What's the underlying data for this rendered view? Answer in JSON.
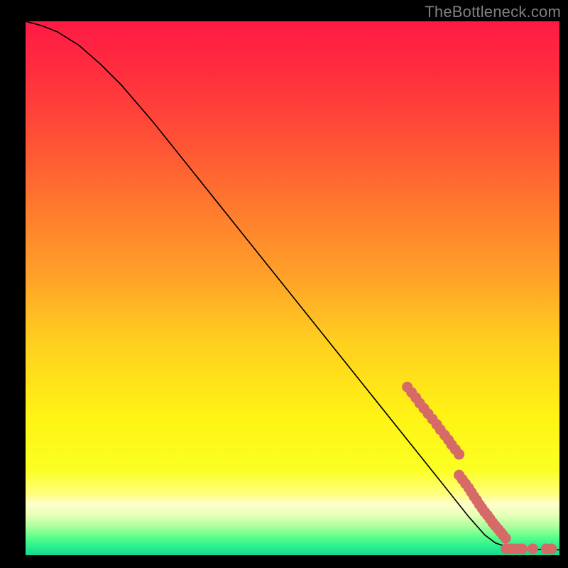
{
  "watermark": "TheBottleneck.com",
  "colors": {
    "background": "#000000",
    "watermark": "#808080",
    "curve": "#000000",
    "point": "#d66a66"
  },
  "gradient_stops": [
    {
      "offset": 0.0,
      "color": "#ff1a44"
    },
    {
      "offset": 0.1,
      "color": "#ff2f3e"
    },
    {
      "offset": 0.22,
      "color": "#ff5036"
    },
    {
      "offset": 0.35,
      "color": "#ff7a2e"
    },
    {
      "offset": 0.48,
      "color": "#ffa229"
    },
    {
      "offset": 0.6,
      "color": "#ffcf1f"
    },
    {
      "offset": 0.74,
      "color": "#fff314"
    },
    {
      "offset": 0.84,
      "color": "#fbff22"
    },
    {
      "offset": 0.885,
      "color": "#ffff80"
    },
    {
      "offset": 0.905,
      "color": "#ffffcc"
    },
    {
      "offset": 0.925,
      "color": "#e6ffb8"
    },
    {
      "offset": 0.945,
      "color": "#b0ff9e"
    },
    {
      "offset": 0.965,
      "color": "#5fff8b"
    },
    {
      "offset": 0.983,
      "color": "#2cf08f"
    },
    {
      "offset": 1.0,
      "color": "#17d892"
    }
  ],
  "chart_data": {
    "type": "line",
    "title": "",
    "xlabel": "",
    "ylabel": "",
    "xlim": [
      0,
      100
    ],
    "ylim": [
      0,
      100
    ],
    "grid": false,
    "legend": false,
    "curve": [
      {
        "x": 0,
        "y": 100
      },
      {
        "x": 3,
        "y": 99.2
      },
      {
        "x": 6,
        "y": 98.0
      },
      {
        "x": 10,
        "y": 95.5
      },
      {
        "x": 14,
        "y": 92.0
      },
      {
        "x": 18,
        "y": 88.0
      },
      {
        "x": 24,
        "y": 81.0
      },
      {
        "x": 30,
        "y": 73.5
      },
      {
        "x": 36,
        "y": 66.0
      },
      {
        "x": 42,
        "y": 58.5
      },
      {
        "x": 48,
        "y": 51.0
      },
      {
        "x": 54,
        "y": 43.5
      },
      {
        "x": 60,
        "y": 36.0
      },
      {
        "x": 66,
        "y": 28.5
      },
      {
        "x": 72,
        "y": 21.0
      },
      {
        "x": 78,
        "y": 13.5
      },
      {
        "x": 83,
        "y": 7.2
      },
      {
        "x": 86,
        "y": 3.8
      },
      {
        "x": 88,
        "y": 2.3
      },
      {
        "x": 90,
        "y": 1.6
      },
      {
        "x": 92,
        "y": 1.3
      },
      {
        "x": 94,
        "y": 1.15
      },
      {
        "x": 96,
        "y": 1.1
      },
      {
        "x": 98,
        "y": 1.05
      },
      {
        "x": 100,
        "y": 1.0
      }
    ],
    "scatter_points": [
      {
        "x": 71.5,
        "y": 31.5
      },
      {
        "x": 72.3,
        "y": 30.5
      },
      {
        "x": 73.1,
        "y": 29.5
      },
      {
        "x": 73.8,
        "y": 28.5
      },
      {
        "x": 74.6,
        "y": 27.5
      },
      {
        "x": 75.4,
        "y": 26.5
      },
      {
        "x": 76.2,
        "y": 25.5
      },
      {
        "x": 77.0,
        "y": 24.5
      },
      {
        "x": 77.7,
        "y": 23.5
      },
      {
        "x": 78.5,
        "y": 22.5
      },
      {
        "x": 79.2,
        "y": 21.6
      },
      {
        "x": 79.8,
        "y": 20.7
      },
      {
        "x": 80.5,
        "y": 19.8
      },
      {
        "x": 81.2,
        "y": 18.9
      },
      {
        "x": 81.2,
        "y": 15.0
      },
      {
        "x": 81.8,
        "y": 14.2
      },
      {
        "x": 82.4,
        "y": 13.4
      },
      {
        "x": 83.0,
        "y": 12.6
      },
      {
        "x": 83.5,
        "y": 11.8
      },
      {
        "x": 84.0,
        "y": 11.0
      },
      {
        "x": 84.5,
        "y": 10.3
      },
      {
        "x": 85.0,
        "y": 9.5
      },
      {
        "x": 85.5,
        "y": 8.8
      },
      {
        "x": 86.0,
        "y": 8.1
      },
      {
        "x": 86.5,
        "y": 7.5
      },
      {
        "x": 87.0,
        "y": 6.8
      },
      {
        "x": 87.5,
        "y": 6.1
      },
      {
        "x": 88.0,
        "y": 5.5
      },
      {
        "x": 88.5,
        "y": 4.9
      },
      {
        "x": 89.0,
        "y": 4.3
      },
      {
        "x": 89.4,
        "y": 3.8
      },
      {
        "x": 89.9,
        "y": 3.2
      },
      {
        "x": 90.0,
        "y": 1.2
      },
      {
        "x": 90.8,
        "y": 1.2
      },
      {
        "x": 91.5,
        "y": 1.2
      },
      {
        "x": 92.3,
        "y": 1.2
      },
      {
        "x": 93.0,
        "y": 1.2
      },
      {
        "x": 95.0,
        "y": 1.2
      },
      {
        "x": 97.5,
        "y": 1.2
      },
      {
        "x": 98.5,
        "y": 1.2
      }
    ]
  }
}
